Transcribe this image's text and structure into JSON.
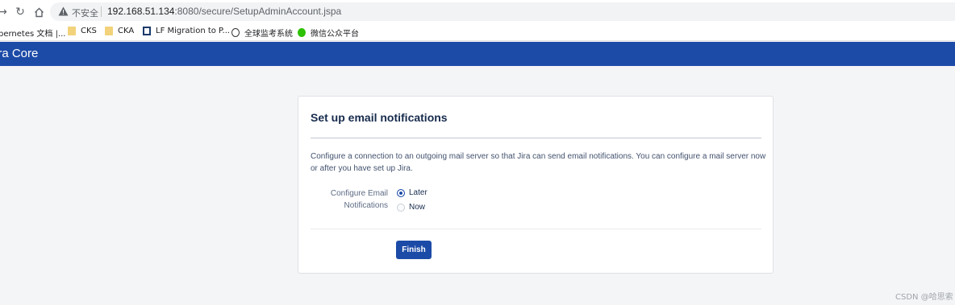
{
  "browser": {
    "insecure_label": "不安全",
    "url_host": "192.168.51.134",
    "url_rest": ":8080/secure/SetupAdminAccount.jspa",
    "bookmarks": [
      {
        "label": "bernetes 文档 |...",
        "icon": "page-icon"
      },
      {
        "label": "CKS",
        "icon": "folder-icon"
      },
      {
        "label": "CKA",
        "icon": "folder-icon"
      },
      {
        "label": "LF Migration to P...",
        "icon": "lf-icon"
      },
      {
        "label": "全球监考系统",
        "icon": "proctor-icon"
      },
      {
        "label": "微信公众平台",
        "icon": "wechat-icon"
      }
    ]
  },
  "header": {
    "title": "ira Core"
  },
  "panel": {
    "title": "Set up email notifications",
    "description": "Configure a connection to an outgoing mail server so that Jira can send email notifications. You can configure a mail server now or after you have set up Jira.",
    "field_label": "Configure Email Notifications",
    "options": [
      {
        "label": "Later",
        "selected": true
      },
      {
        "label": "Now",
        "selected": false
      }
    ],
    "finish_label": "Finish"
  },
  "watermark": "CSDN @哈思索",
  "colors": {
    "brand": "#1c4ba7",
    "page_bg": "#f4f5f7"
  }
}
